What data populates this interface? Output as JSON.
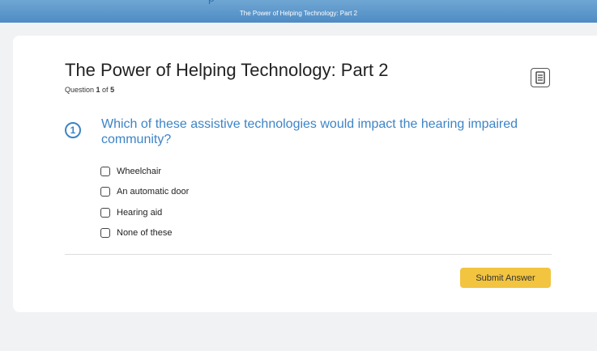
{
  "topbar": {
    "title": "The Power of Helping Technology: Part 2"
  },
  "quiz": {
    "title": "The Power of Helping Technology: Part 2",
    "progress_prefix": "Question ",
    "current": "1",
    "progress_mid": " of ",
    "total": "5"
  },
  "question": {
    "number": "1",
    "text": "Which of these assistive technologies would impact the hearing impaired community?",
    "options": [
      {
        "label": "Wheelchair",
        "checked": false
      },
      {
        "label": "An automatic door",
        "checked": false
      },
      {
        "label": "Hearing aid",
        "checked": false
      },
      {
        "label": "None of these",
        "checked": false
      }
    ]
  },
  "submit_label": "Submit Answer",
  "icons": {
    "notes": "notes-icon"
  },
  "colors": {
    "header": "#4f8cc4",
    "accent": "#3d84c6",
    "submit": "#f2c440"
  }
}
